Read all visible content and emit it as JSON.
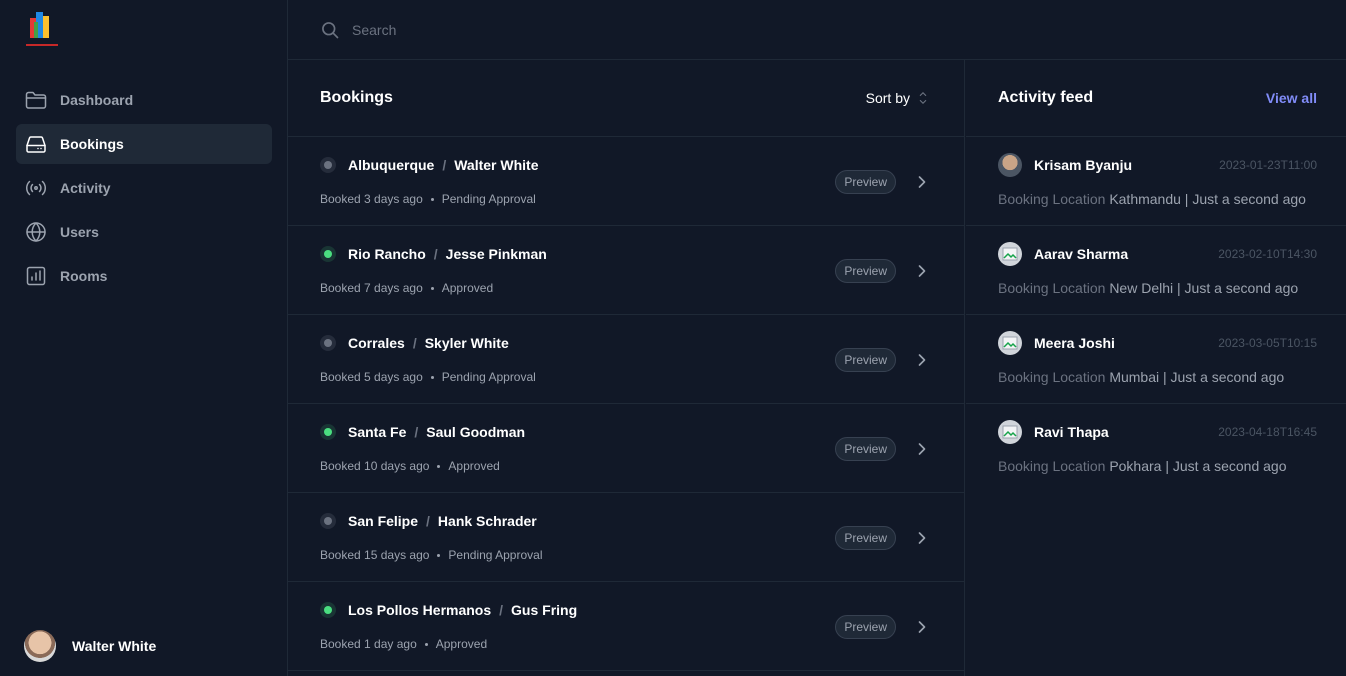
{
  "search": {
    "placeholder": "Search"
  },
  "sidebar": {
    "items": [
      {
        "label": "Dashboard",
        "icon": "folder-icon"
      },
      {
        "label": "Bookings",
        "icon": "inbox-icon",
        "active": true
      },
      {
        "label": "Activity",
        "icon": "signal-icon"
      },
      {
        "label": "Users",
        "icon": "globe-icon"
      },
      {
        "label": "Rooms",
        "icon": "chart-bar-icon"
      }
    ],
    "profile": {
      "name": "Walter White"
    }
  },
  "bookings": {
    "title": "Bookings",
    "sort_label": "Sort by",
    "preview_label": "Preview",
    "items": [
      {
        "location": "Albuquerque",
        "name": "Walter White",
        "booked": "Booked 3 days ago",
        "status": "Pending Approval",
        "status_color": "gray"
      },
      {
        "location": "Rio Rancho",
        "name": "Jesse Pinkman",
        "booked": "Booked 7 days ago",
        "status": "Approved",
        "status_color": "green"
      },
      {
        "location": "Corrales",
        "name": "Skyler White",
        "booked": "Booked 5 days ago",
        "status": "Pending Approval",
        "status_color": "gray"
      },
      {
        "location": "Santa Fe",
        "name": "Saul Goodman",
        "booked": "Booked 10 days ago",
        "status": "Approved",
        "status_color": "green"
      },
      {
        "location": "San Felipe",
        "name": "Hank Schrader",
        "booked": "Booked 15 days ago",
        "status": "Pending Approval",
        "status_color": "gray"
      },
      {
        "location": "Los Pollos Hermanos",
        "name": "Gus Fring",
        "booked": "Booked 1 day ago",
        "status": "Approved",
        "status_color": "green"
      }
    ]
  },
  "activity": {
    "title": "Activity feed",
    "view_all": "View all",
    "prefix": "Booking Location",
    "items": [
      {
        "name": "Krisam Byanju",
        "time": "2023-01-23T11:00",
        "detail": "Kathmandu | Just a second ago"
      },
      {
        "name": "Aarav Sharma",
        "time": "2023-02-10T14:30",
        "detail": "New Delhi | Just a second ago"
      },
      {
        "name": "Meera Joshi",
        "time": "2023-03-05T10:15",
        "detail": "Mumbai | Just a second ago"
      },
      {
        "name": "Ravi Thapa",
        "time": "2023-04-18T16:45",
        "detail": "Pokhara | Just a second ago"
      }
    ]
  },
  "colors": {
    "accent": "#818cf8",
    "approved": "#4ade80",
    "pending": "#6b7280",
    "background": "#111827"
  }
}
